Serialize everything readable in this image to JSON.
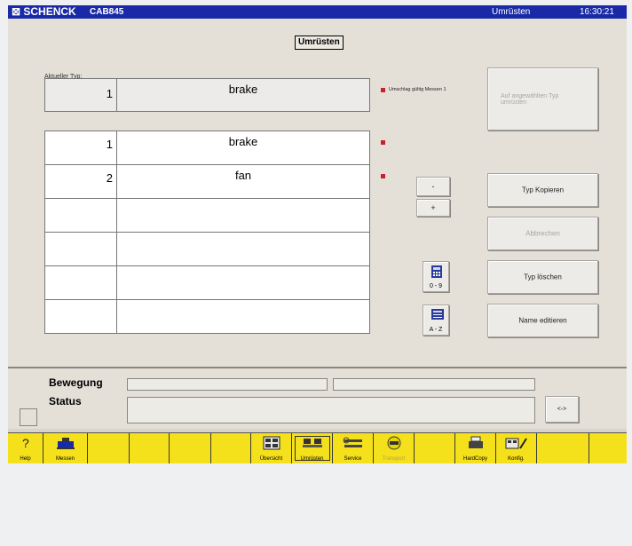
{
  "titlebar": {
    "brand": "⊠ SCHENCK",
    "model": "CAB845",
    "mode": "Umrüsten",
    "time": "16:30:21"
  },
  "page": {
    "title": "Umrüsten",
    "current_type_label": "Aktueller Typ:"
  },
  "current_type": {
    "number": "1",
    "name": "brake",
    "flag_label": "Umschlag gültig Messen 1"
  },
  "type_list": [
    {
      "number": "1",
      "name": "brake"
    },
    {
      "number": "2",
      "name": "fan"
    },
    {
      "number": "",
      "name": ""
    },
    {
      "number": "",
      "name": ""
    },
    {
      "number": "",
      "name": ""
    },
    {
      "number": "",
      "name": ""
    }
  ],
  "buttons": {
    "switch_to_selected": "Auf angewählten Typ umrüsten",
    "minus": "-",
    "plus": "+",
    "copy_type": "Typ Kopieren",
    "cancel": "Abbrechen",
    "delete_type": "Typ löschen",
    "edit_name": "Name editieren",
    "numpad": "0 - 9",
    "alpha": "A - Z",
    "arrow": "<->"
  },
  "status": {
    "movement_label": "Bewegung",
    "status_label": "Status"
  },
  "taskbar": [
    {
      "label": "Help",
      "icon": "help-icon"
    },
    {
      "label": "Messen",
      "icon": "measure-icon"
    },
    {
      "label": "",
      "icon": ""
    },
    {
      "label": "",
      "icon": ""
    },
    {
      "label": "",
      "icon": ""
    },
    {
      "label": "",
      "icon": ""
    },
    {
      "label": "Übersicht",
      "icon": "overview-icon"
    },
    {
      "label": "Umrüsten",
      "icon": "changeover-icon"
    },
    {
      "label": "Service",
      "icon": "wrench-icon"
    },
    {
      "label": "Transport",
      "icon": "transport-icon"
    },
    {
      "label": "",
      "icon": ""
    },
    {
      "label": "HardCopy",
      "icon": "printer-icon"
    },
    {
      "label": "Konfig.",
      "icon": "config-icon"
    },
    {
      "label": "",
      "icon": ""
    }
  ],
  "colors": {
    "titlebar": "#1a2aa6",
    "taskbar": "#f5e01c",
    "flag_red": "#c8202c"
  }
}
